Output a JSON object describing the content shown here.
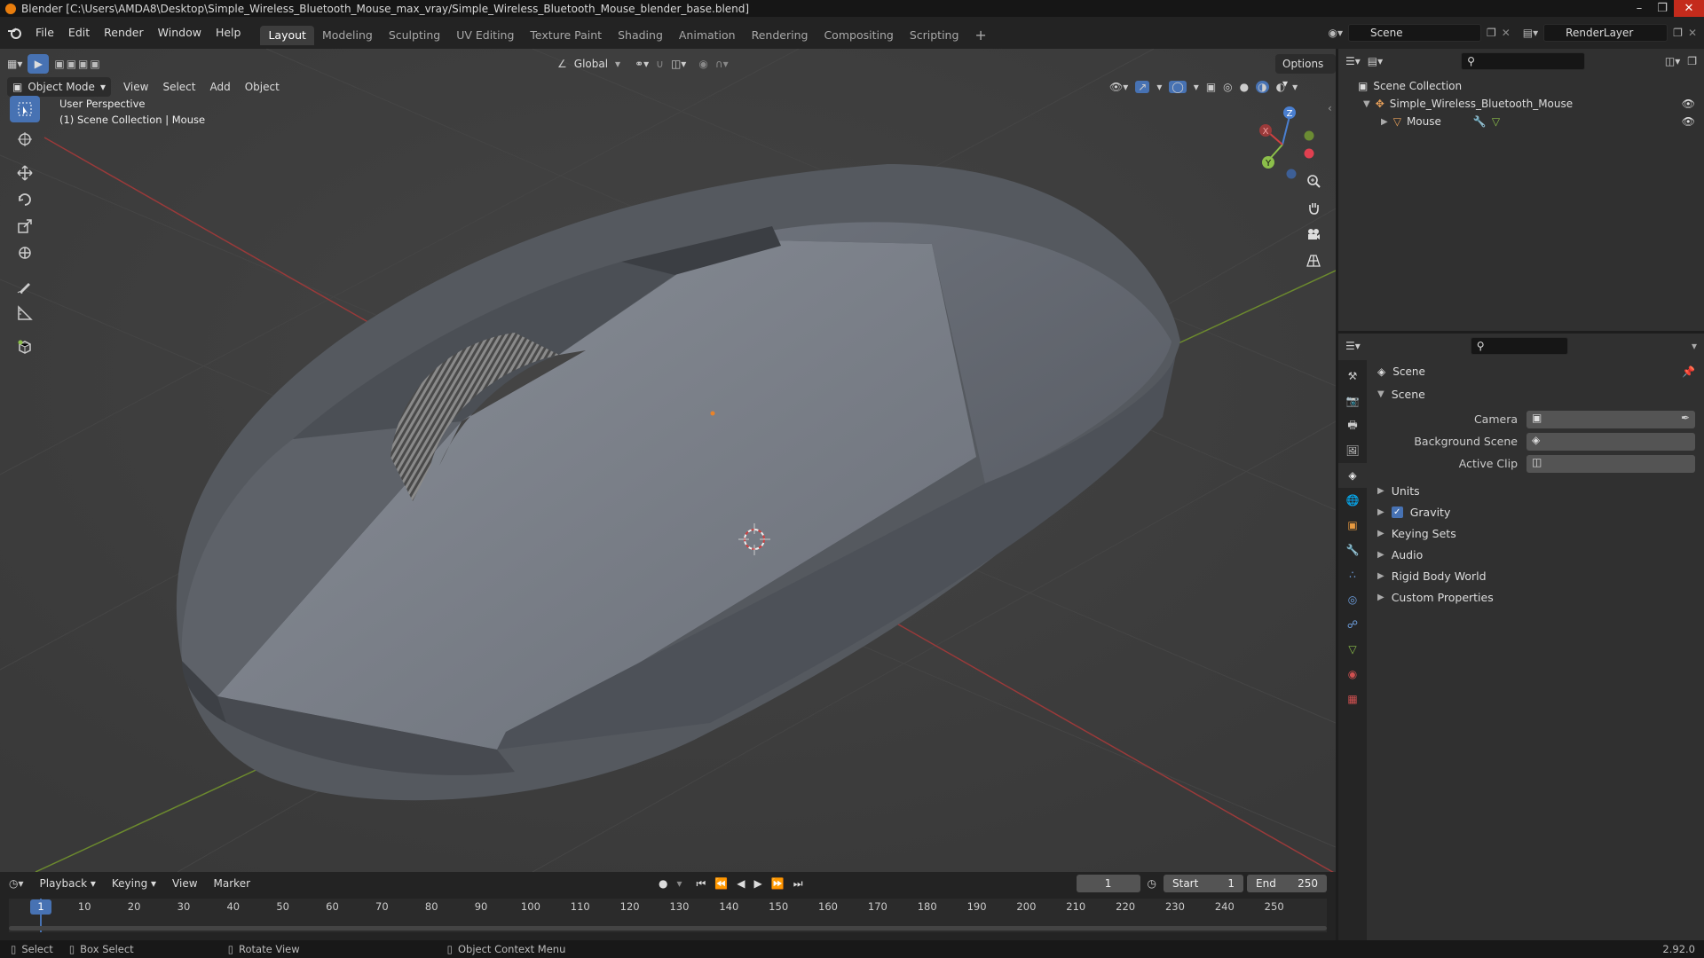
{
  "titlebar": {
    "title": "Blender [C:\\Users\\AMDA8\\Desktop\\Simple_Wireless_Bluetooth_Mouse_max_vray/Simple_Wireless_Bluetooth_Mouse_blender_base.blend]"
  },
  "menubar": {
    "menus": [
      "File",
      "Edit",
      "Render",
      "Window",
      "Help"
    ],
    "workspaces": [
      "Layout",
      "Modeling",
      "Sculpting",
      "UV Editing",
      "Texture Paint",
      "Shading",
      "Animation",
      "Rendering",
      "Compositing",
      "Scripting"
    ],
    "active_workspace": "Layout",
    "add_tab": "+",
    "scene_name": "Scene",
    "view_layer": "RenderLayer"
  },
  "viewport": {
    "transform_orientation": "Global",
    "options_label": "Options",
    "mode": "Object Mode",
    "menus": [
      "View",
      "Select",
      "Add",
      "Object"
    ],
    "overlay_line1": "User Perspective",
    "overlay_line2": "(1) Scene Collection | Mouse",
    "gizmo_axes": {
      "x": "X",
      "y": "Y",
      "z": "Z"
    },
    "accent": "#4772b3"
  },
  "outliner": {
    "root": "Scene Collection",
    "collection": "Simple_Wireless_Bluetooth_Mouse",
    "object": "Mouse"
  },
  "properties": {
    "header_title": "Scene",
    "panel_title": "Scene",
    "fields": [
      {
        "label": "Camera",
        "value": ""
      },
      {
        "label": "Background Scene",
        "value": ""
      },
      {
        "label": "Active Clip",
        "value": ""
      }
    ],
    "sections": [
      "Units",
      "Gravity",
      "Keying Sets",
      "Audio",
      "Rigid Body World",
      "Custom Properties"
    ],
    "gravity_checked": true
  },
  "timeline": {
    "menus": [
      "Playback",
      "Keying",
      "View",
      "Marker"
    ],
    "current_frame": "1",
    "start_label": "Start",
    "start_value": "1",
    "end_label": "End",
    "end_value": "250",
    "ticks": [
      "1",
      "10",
      "20",
      "30",
      "40",
      "50",
      "60",
      "70",
      "80",
      "90",
      "100",
      "110",
      "120",
      "130",
      "140",
      "150",
      "160",
      "170",
      "180",
      "190",
      "200",
      "210",
      "220",
      "230",
      "240",
      "250"
    ]
  },
  "statusbar": {
    "select": "Select",
    "box_select": "Box Select",
    "rotate_view": "Rotate View",
    "context_menu": "Object Context Menu",
    "version": "2.92.0"
  }
}
